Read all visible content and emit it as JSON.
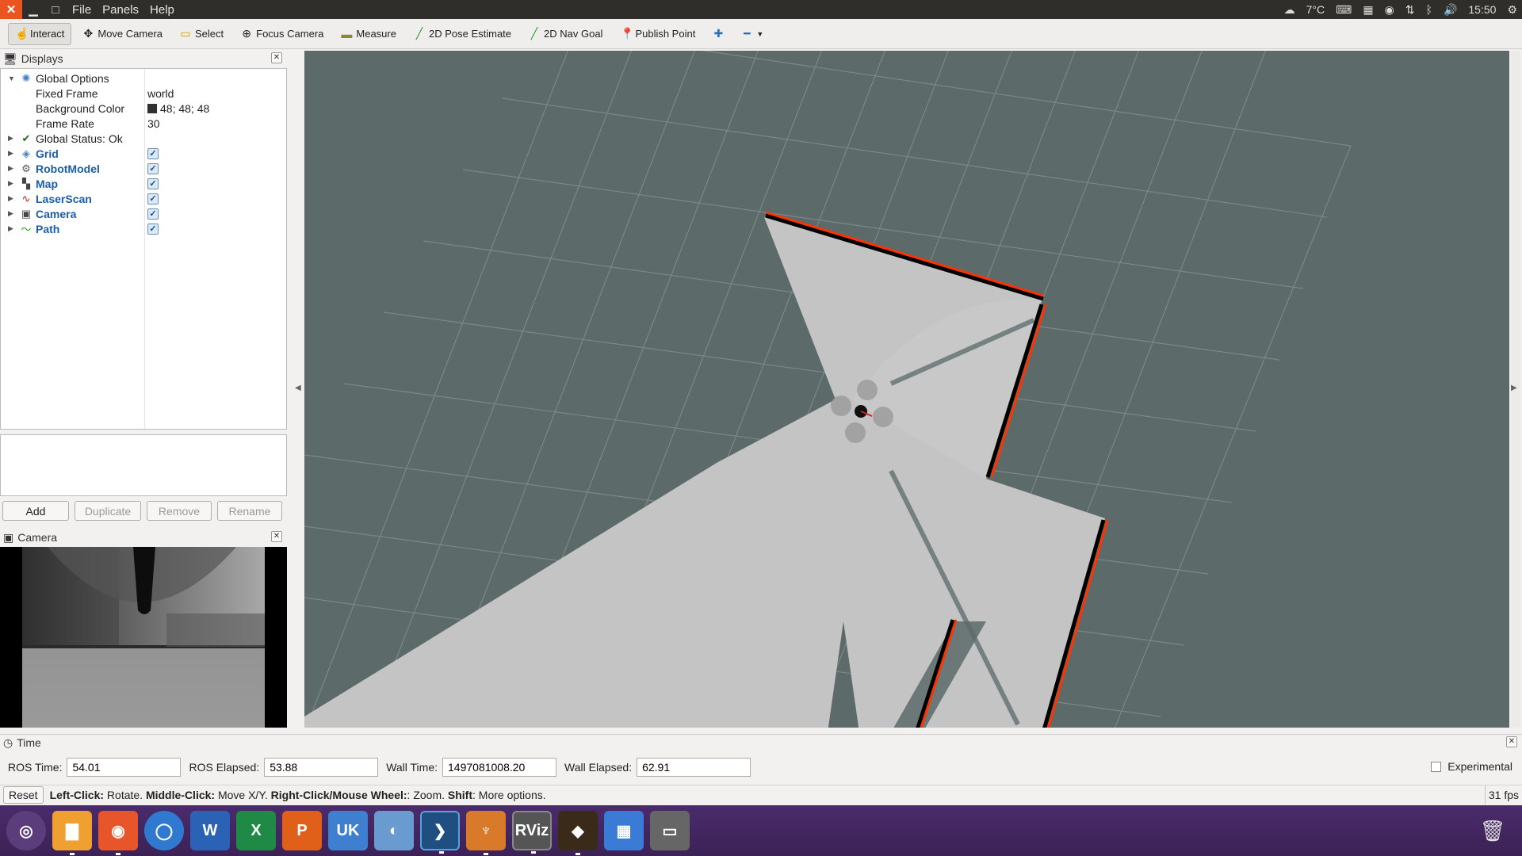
{
  "menubar": {
    "menus": [
      "File",
      "Panels",
      "Help"
    ],
    "weather": "7°C",
    "time": "15:50"
  },
  "toolbar": {
    "tools": [
      {
        "label": "Interact",
        "icon": "hand-icon"
      },
      {
        "label": "Move Camera",
        "icon": "move-camera-icon"
      },
      {
        "label": "Select",
        "icon": "select-icon"
      },
      {
        "label": "Focus Camera",
        "icon": "focus-camera-icon"
      },
      {
        "label": "Measure",
        "icon": "measure-icon"
      },
      {
        "label": "2D Pose Estimate",
        "icon": "pose-arrow-icon"
      },
      {
        "label": "2D Nav Goal",
        "icon": "goal-arrow-icon"
      },
      {
        "label": "Publish Point",
        "icon": "pin-icon"
      }
    ]
  },
  "displays": {
    "title": "Displays",
    "global_options": "Global Options",
    "fixed_frame_label": "Fixed Frame",
    "fixed_frame_value": "world",
    "bg_color_label": "Background Color",
    "bg_color_value": "48; 48; 48",
    "frame_rate_label": "Frame Rate",
    "frame_rate_value": "30",
    "global_status": "Global Status: Ok",
    "items": [
      {
        "name": "Grid",
        "icon": "grid-icon",
        "color": "#1a5ea8"
      },
      {
        "name": "RobotModel",
        "icon": "robot-icon",
        "color": "#1a5ea8"
      },
      {
        "name": "Map",
        "icon": "map-icon",
        "color": "#1a5ea8"
      },
      {
        "name": "LaserScan",
        "icon": "laser-icon",
        "color": "#1a5ea8"
      },
      {
        "name": "Camera",
        "icon": "camera-icon",
        "color": "#1a5ea8"
      },
      {
        "name": "Path",
        "icon": "path-icon",
        "color": "#1a5ea8"
      }
    ],
    "buttons": {
      "add": "Add",
      "duplicate": "Duplicate",
      "remove": "Remove",
      "rename": "Rename"
    }
  },
  "camera_panel": {
    "title": "Camera"
  },
  "time_panel": {
    "title": "Time",
    "ros_time_label": "ROS Time:",
    "ros_time": "54.01",
    "ros_elapsed_label": "ROS Elapsed:",
    "ros_elapsed": "53.88",
    "wall_time_label": "Wall Time:",
    "wall_time": "1497081008.20",
    "wall_elapsed_label": "Wall Elapsed:",
    "wall_elapsed": "62.91",
    "experimental": "Experimental"
  },
  "statusbar": {
    "reset": "Reset",
    "left_click": "Left-Click:",
    "left_click_action": " Rotate. ",
    "middle_click": "Middle-Click:",
    "middle_click_action": " Move X/Y. ",
    "right_click": "Right-Click/Mouse Wheel:",
    "right_click_action": ": Zoom. ",
    "shift": "Shift",
    "shift_action": ": More options.",
    "fps": "31 fps"
  },
  "colors": {
    "accent": "#e95420",
    "render_bg": "#5c6b6a",
    "free_space": "#c4c4c4",
    "wall": "#000000",
    "laser": "#ff3300",
    "dock": "#3b2256"
  }
}
